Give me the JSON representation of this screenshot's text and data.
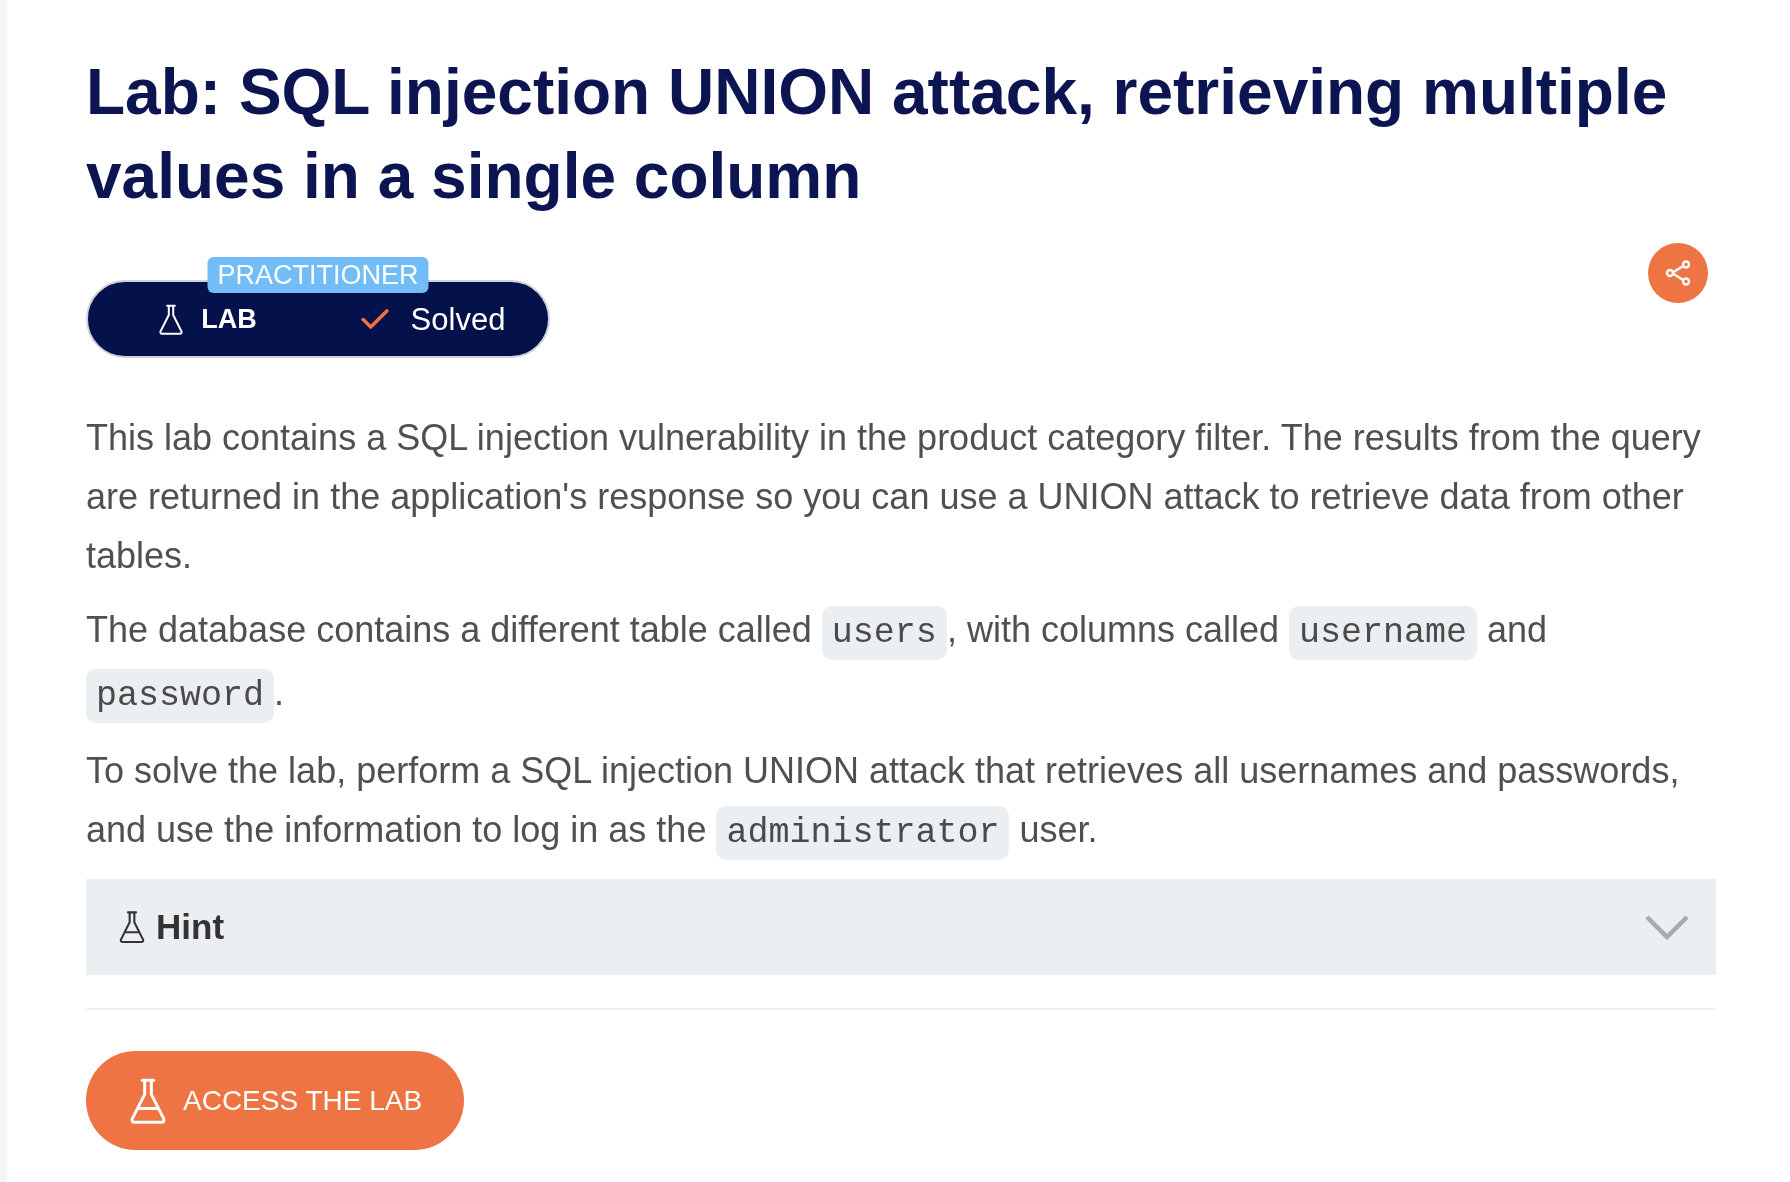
{
  "title": "Lab: SQL injection UNION attack, retrieving multiple values in a single column",
  "badge": {
    "difficulty": "PRACTITIONER",
    "label": "LAB",
    "status": "Solved",
    "solved": true
  },
  "description": [
    {
      "segments": [
        {
          "kind": "text",
          "text": "This lab contains a SQL injection vulnerability in the product category filter. The results from the query are returned in the application's response so you can use a UNION attack to retrieve data from other tables."
        }
      ]
    },
    {
      "segments": [
        {
          "kind": "text",
          "text": "The database contains a different table called "
        },
        {
          "kind": "code",
          "text": "users"
        },
        {
          "kind": "text",
          "text": ", with columns called "
        },
        {
          "kind": "code",
          "text": "username"
        },
        {
          "kind": "text",
          "text": " and "
        },
        {
          "kind": "code",
          "text": "password"
        },
        {
          "kind": "text",
          "text": "."
        }
      ]
    },
    {
      "segments": [
        {
          "kind": "text",
          "text": "To solve the lab, perform a SQL injection UNION attack that retrieves all usernames and passwords, and use the information to log in as the "
        },
        {
          "kind": "code",
          "text": "administrator"
        },
        {
          "kind": "text",
          "text": " user."
        }
      ]
    }
  ],
  "hint": {
    "label": "Hint",
    "expanded": false
  },
  "access_button": {
    "label": "ACCESS THE LAB"
  }
}
